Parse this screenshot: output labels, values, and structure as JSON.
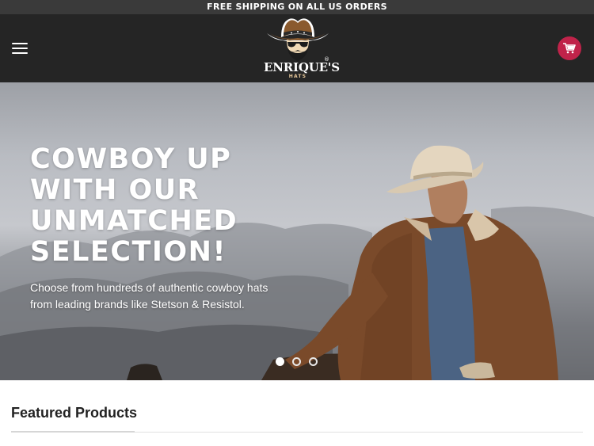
{
  "announcement": {
    "text": "FREE SHIPPING ON ALL US ORDERS"
  },
  "header": {
    "menu_icon": "hamburger-menu-icon",
    "logo": {
      "name": "ENRIQUE'S",
      "subtitle": "HATS",
      "mark": "®"
    },
    "cart_icon": "shopping-cart-icon",
    "cart_color": "#c0234a"
  },
  "hero": {
    "title": "COWBOY UP WITH OUR UNMATCHED SELECTION!",
    "subtitle": "Choose from hundreds of authentic cowboy hats from leading brands like Stetson & Resistol.",
    "slides": {
      "count": 3,
      "active": 1
    }
  },
  "featured": {
    "title": "Featured Products"
  }
}
